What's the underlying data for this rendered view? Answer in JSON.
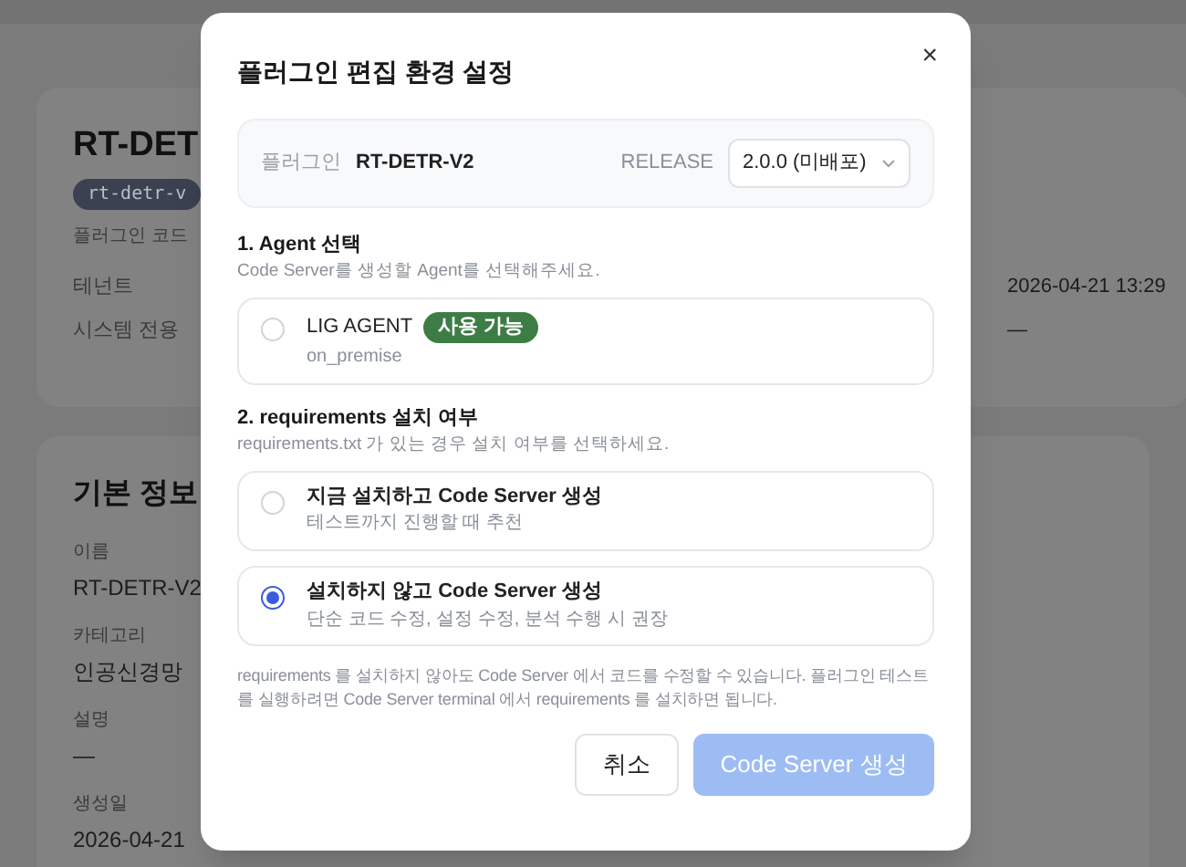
{
  "background_page": {
    "header_card": {
      "title": "RT-DET",
      "slug_badge": "rt-detr-v",
      "description": "플러그인 코드",
      "fields": [
        {
          "label": "테넌트",
          "value": "2026-04-21 13:29"
        },
        {
          "label": "시스템 전용",
          "value": "—"
        }
      ]
    },
    "info_card": {
      "title": "기본 정보",
      "fields": [
        {
          "label": "이름",
          "value": "RT-DETR-V2"
        },
        {
          "label": "카테고리",
          "value": "인공신경망"
        },
        {
          "label": "설명",
          "value": "—"
        },
        {
          "label": "생성일",
          "value": "2026-04-21"
        }
      ]
    }
  },
  "dialog": {
    "title": "플러그인 편집 환경 설정",
    "close": "×",
    "plugin": {
      "label": "플러그인",
      "name": "RT-DETR-V2",
      "release_label": "RELEASE",
      "release_value": "2.0.0 (미배포)"
    },
    "sections": [
      {
        "heading": "1. Agent 선택",
        "hint": "Code Server를 생성할 Agent를 선택해주세요.",
        "options": [
          {
            "title": "LIG AGENT",
            "badge": "사용 가능",
            "subtitle": "on_premise",
            "selected": false
          }
        ]
      },
      {
        "heading": "2. requirements 설치 여부",
        "hint": "requirements.txt 가 있는 경우 설치 여부를 선택하세요.",
        "options": [
          {
            "title": "지금 설치하고 Code Server 생성",
            "subtitle": "테스트까지 진행할 때 추천",
            "selected": false
          },
          {
            "title": "설치하지 않고 Code Server 생성",
            "subtitle": "단순 코드 수정, 설정 수정, 분석 수행 시 권장",
            "selected": true
          }
        ]
      }
    ],
    "note": "requirements 를 설치하지 않아도 Code Server 에서 코드를 수정할 수 있습니다. 플러그인 테스트를 실행하려면 Code Server terminal 에서 requirements 를 설치하면 됩니다.",
    "buttons": [
      {
        "label": "취소",
        "kind": "secondary",
        "disabled": false
      },
      {
        "label": "Code Server 생성",
        "kind": "primary",
        "disabled": true
      }
    ]
  }
}
